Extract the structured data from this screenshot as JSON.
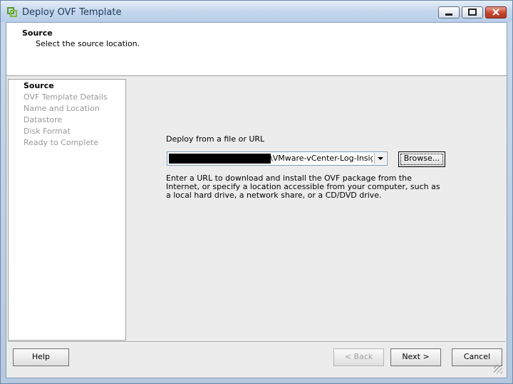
{
  "window": {
    "title": "Deploy OVF Template"
  },
  "header": {
    "title": "Source",
    "subtitle": "Select the source location."
  },
  "steps": [
    "Source",
    "OVF Template Details",
    "Name and Location",
    "Datastore",
    "Disk Format",
    "Ready to Complete"
  ],
  "source": {
    "label": "Deploy from a file or URL",
    "combo_value": "\\VMware-vCenter-Log-Insight-",
    "browse_label": "Browse...",
    "help_text": "Enter a URL to download and install the OVF package from the Internet, or specify a location accessible from your computer, such as a local hard drive, a network share, or a CD/DVD drive."
  },
  "buttons": {
    "help": "Help",
    "back": "< Back",
    "next": "Next >",
    "cancel": "Cancel"
  },
  "colors": {
    "titlebar": "#c5d7ee",
    "close_button": "#c8432c",
    "panel": "#ececec"
  }
}
